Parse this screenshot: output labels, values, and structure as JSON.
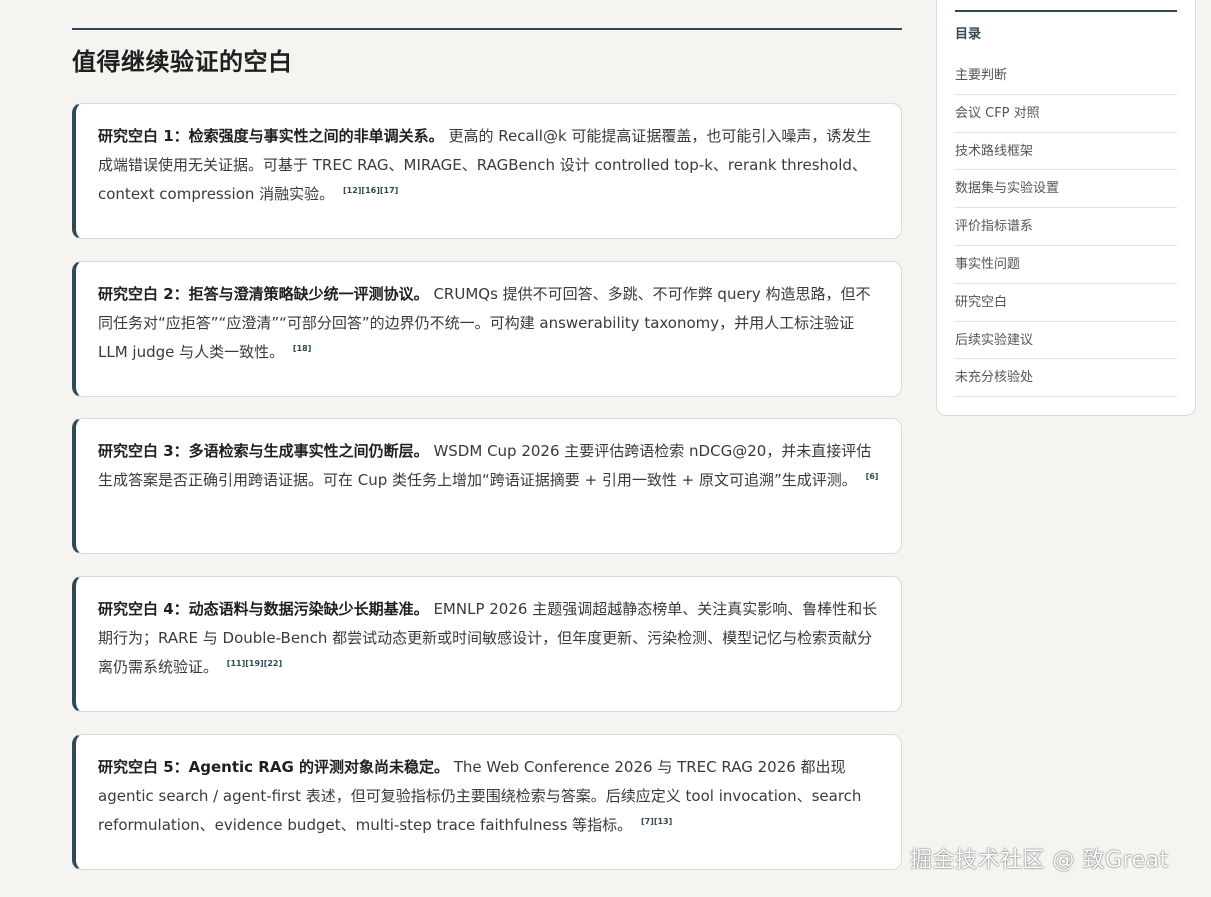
{
  "section": {
    "title": "值得继续验证的空白"
  },
  "cards": [
    {
      "lead": "研究空白 1：检索强度与事实性之间的非单调关系。",
      "body": "更高的 Recall@k 可能提高证据覆盖，也可能引入噪声，诱发生成端错误使用无关证据。可基于 TREC RAG、MIRAGE、RAGBench 设计 controlled top-k、rerank threshold、context compression 消融实验。",
      "refs": "[12][16][17]"
    },
    {
      "lead": "研究空白 2：拒答与澄清策略缺少统一评测协议。",
      "body": "CRUMQs 提供不可回答、多跳、不可作弊 query 构造思路，但不同任务对“应拒答”“应澄清”“可部分回答”的边界仍不统一。可构建 answerability taxonomy，并用人工标注验证 LLM judge 与人类一致性。",
      "refs": "[18]"
    },
    {
      "lead": "研究空白 3：多语检索与生成事实性之间仍断层。",
      "body": "WSDM Cup 2026 主要评估跨语检索 nDCG@20，并未直接评估生成答案是否正确引用跨语证据。可在 Cup 类任务上增加“跨语证据摘要 + 引用一致性 + 原文可追溯”生成评测。",
      "refs": "[6]"
    },
    {
      "lead": "研究空白 4：动态语料与数据污染缺少长期基准。",
      "body": "EMNLP 2026 主题强调超越静态榜单、关注真实影响、鲁棒性和长期行为；RARE 与 Double-Bench 都尝试动态更新或时间敏感设计，但年度更新、污染检测、模型记忆与检索贡献分离仍需系统验证。",
      "refs": "[11][19][22]"
    },
    {
      "lead": "研究空白 5：Agentic RAG 的评测对象尚未稳定。",
      "body": "The Web Conference 2026 与 TREC RAG 2026 都出现 agentic search / agent-first 表述，但可复验指标仍主要围绕检索与答案。后续应定义 tool invocation、search reformulation、evidence budget、multi-step trace faithfulness 等指标。",
      "refs": "[7][13]"
    }
  ],
  "toc": {
    "title": "目录",
    "items": [
      "主要判断",
      "会议 CFP 对照",
      "技术路线框架",
      "数据集与实验设置",
      "评价指标谱系",
      "事实性问题",
      "研究空白",
      "后续实验建议",
      "未充分核验处"
    ]
  },
  "watermark": "掘金技术社区 @ 致Great",
  "colors": {
    "accent": "#2f4a57",
    "background": "#f5f4f0",
    "card": "#ffffff"
  }
}
